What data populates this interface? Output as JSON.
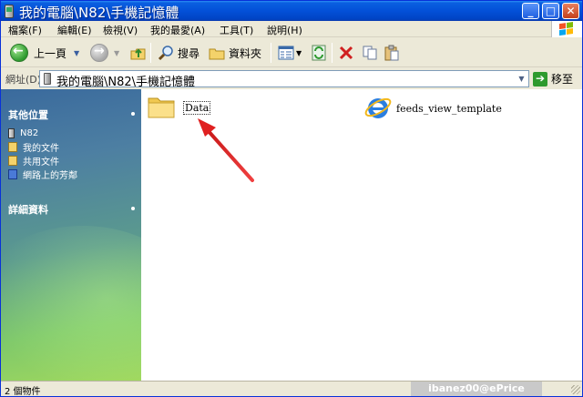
{
  "window": {
    "title": "我的電腦\\N82\\手機記憶體"
  },
  "menu": {
    "items": [
      "檔案(F)",
      "編輯(E)",
      "檢視(V)",
      "我的最愛(A)",
      "工具(T)",
      "說明(H)"
    ]
  },
  "toolbar": {
    "back_label": "上一頁",
    "search_label": "搜尋",
    "folders_label": "資料夾"
  },
  "address": {
    "label": "網址(D)",
    "value": "我的電腦\\N82\\手機記憶體",
    "go_label": "移至"
  },
  "taskpane": {
    "other_places_title": "其他位置",
    "places": [
      "N82",
      "我的文件",
      "共用文件",
      "網路上的芳鄰"
    ],
    "details_title": "詳細資料"
  },
  "content": {
    "items": [
      {
        "label": "Data",
        "icon": "folder-icon",
        "selected": true
      },
      {
        "label": "feeds_view_template",
        "icon": "internet-explorer-icon",
        "selected": false
      }
    ]
  },
  "status": {
    "text": "2 個物件",
    "watermark": "ibanez00@ePrice"
  },
  "colors": {
    "titlebar": "#0350d8",
    "annotation_arrow": "#e02020"
  }
}
